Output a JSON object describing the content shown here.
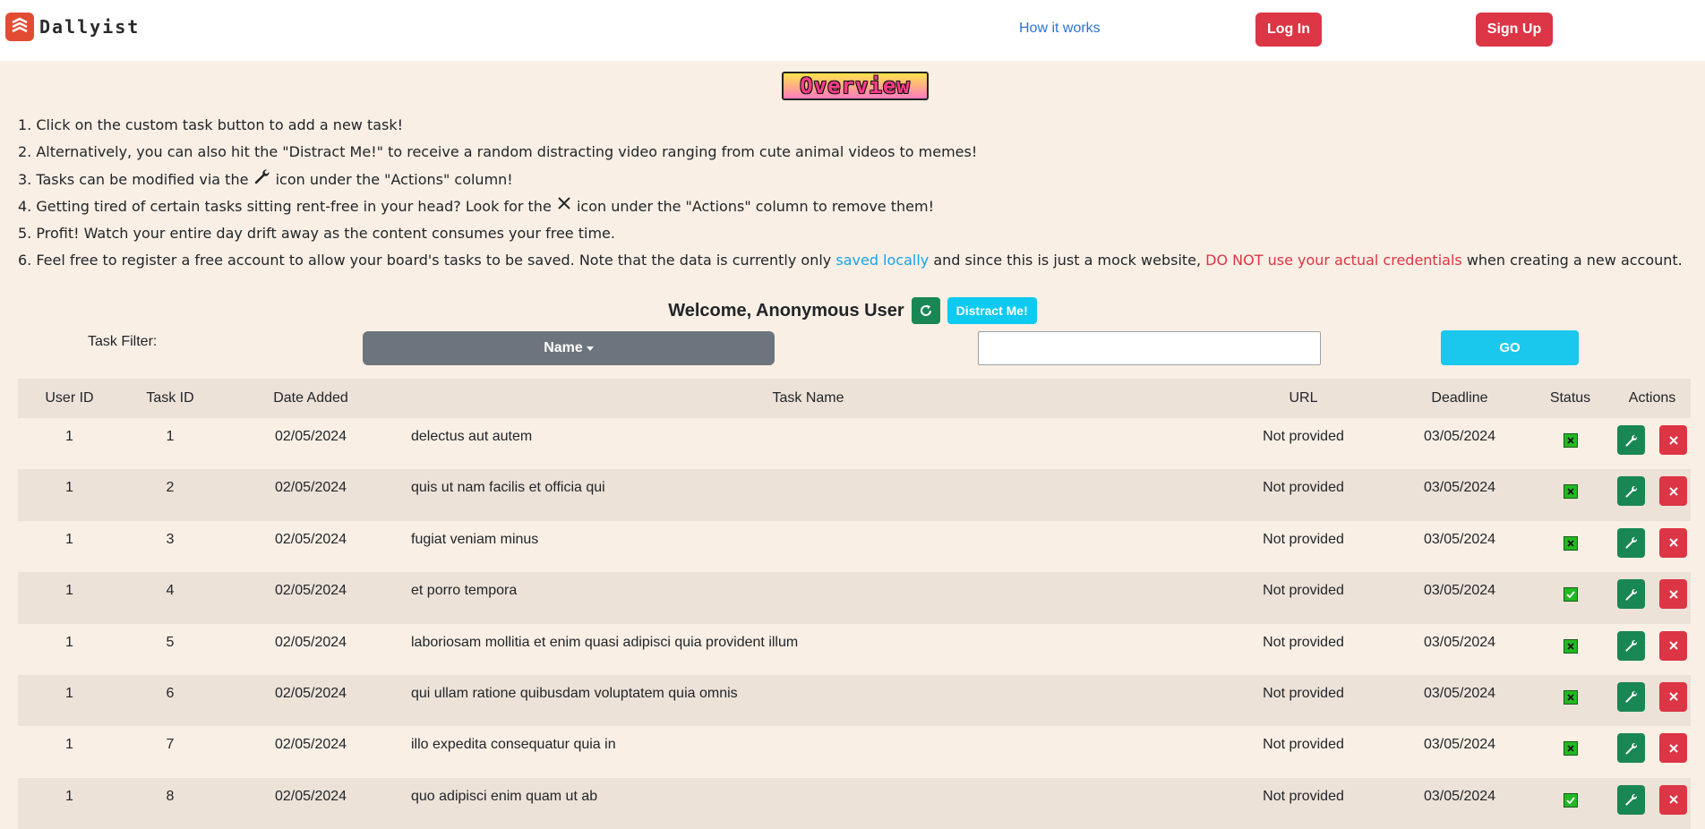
{
  "nav": {
    "brand": "Dallyist",
    "how_it_works": "How it works",
    "login": "Log In",
    "signup": "Sign Up"
  },
  "overview": {
    "title": "Overview",
    "lines": [
      "1. Click on the custom task button to add a new task!",
      "2. Alternatively, you can also hit the \"Distract Me!\" to receive a random distracting video ranging from cute animal videos to memes!",
      {
        "before": "3. Tasks can be modified via the ",
        "after": " icon under the \"Actions\" column!"
      },
      {
        "before": "4. Getting tired of certain tasks sitting rent-free in your head? Look for the ",
        "after": " icon under the \"Actions\" column to remove them!"
      },
      "5. Profit! Watch your entire day drift away as the content consumes your free time.",
      {
        "before": "6. Feel free to register a free account to allow your board's tasks to be saved. Note that the data is currently only ",
        "blue": "saved locally",
        "middle": " and since this is just a mock website, ",
        "red": "DO NOT use your actual credentials",
        "after": " when creating a new account."
      }
    ]
  },
  "welcome": {
    "text": "Welcome, Anonymous User",
    "distract": "Distract Me!"
  },
  "filter": {
    "label": "Task Filter:",
    "dropdown": "Name",
    "input_value": "",
    "go": "GO"
  },
  "table": {
    "headers": [
      "User ID",
      "Task ID",
      "Date Added",
      "Task Name",
      "URL",
      "Deadline",
      "Status",
      "Actions"
    ],
    "rows": [
      {
        "user_id": "1",
        "task_id": "1",
        "date_added": "02/05/2024",
        "name": "delectus aut autem",
        "url": "Not provided",
        "deadline": "03/05/2024",
        "status": "incomplete"
      },
      {
        "user_id": "1",
        "task_id": "2",
        "date_added": "02/05/2024",
        "name": "quis ut nam facilis et officia qui",
        "url": "Not provided",
        "deadline": "03/05/2024",
        "status": "incomplete"
      },
      {
        "user_id": "1",
        "task_id": "3",
        "date_added": "02/05/2024",
        "name": "fugiat veniam minus",
        "url": "Not provided",
        "deadline": "03/05/2024",
        "status": "incomplete"
      },
      {
        "user_id": "1",
        "task_id": "4",
        "date_added": "02/05/2024",
        "name": "et porro tempora",
        "url": "Not provided",
        "deadline": "03/05/2024",
        "status": "complete"
      },
      {
        "user_id": "1",
        "task_id": "5",
        "date_added": "02/05/2024",
        "name": "laboriosam mollitia et enim quasi adipisci quia provident illum",
        "url": "Not provided",
        "deadline": "03/05/2024",
        "status": "incomplete"
      },
      {
        "user_id": "1",
        "task_id": "6",
        "date_added": "02/05/2024",
        "name": "qui ullam ratione quibusdam voluptatem quia omnis",
        "url": "Not provided",
        "deadline": "03/05/2024",
        "status": "incomplete"
      },
      {
        "user_id": "1",
        "task_id": "7",
        "date_added": "02/05/2024",
        "name": "illo expedita consequatur quia in",
        "url": "Not provided",
        "deadline": "03/05/2024",
        "status": "incomplete"
      },
      {
        "user_id": "1",
        "task_id": "8",
        "date_added": "02/05/2024",
        "name": "quo adipisci enim quam ut ab",
        "url": "Not provided",
        "deadline": "03/05/2024",
        "status": "complete"
      }
    ]
  },
  "colors": {
    "page_bg": "#f9efe5",
    "row_alt_bg": "#ede2d8",
    "danger": "#dc3545",
    "success": "#198754",
    "info": "#0dcaf0",
    "secondary": "#6c757d"
  },
  "icons": {
    "brand": "stacked-layers-icon",
    "refresh": "refresh-icon",
    "edit": "wrench-icon",
    "delete": "close-icon",
    "status_complete": "checkbox-checked-icon",
    "status_incomplete": "checkbox-x-icon"
  }
}
